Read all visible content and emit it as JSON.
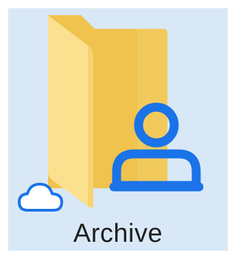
{
  "item": {
    "name": "Archive",
    "type": "shared folder",
    "sync_status_icon": "cloud-icon",
    "overlay_icon": "person-icon",
    "selected": true
  },
  "colors": {
    "selection_bg": "#d9e8f6",
    "folder_back": "#f2c94f",
    "folder_front": "#fbe08f",
    "person_overlay": "#1a73e8",
    "cloud_outline": "#1a73e8",
    "label_text": "#1e1e1e"
  }
}
